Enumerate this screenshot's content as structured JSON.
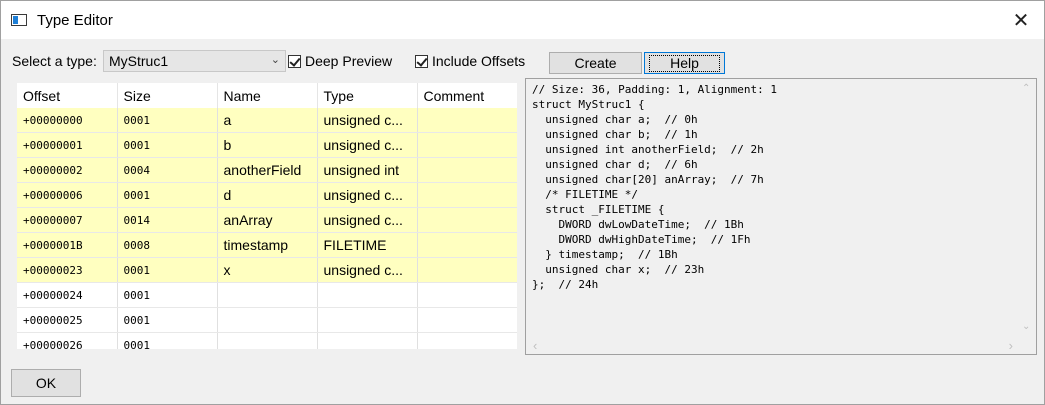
{
  "window": {
    "title": "Type Editor",
    "close_glyph": "✕"
  },
  "toolbar": {
    "select_label": "Select a type:",
    "type_value": "MyStruc1",
    "deep_preview_label": "Deep Preview",
    "include_offsets_label": "Include Offsets",
    "create_label": "Create",
    "help_label": "Help"
  },
  "grid": {
    "columns": [
      "Offset",
      "Size",
      "Name",
      "Type",
      "Comment"
    ],
    "rows": [
      {
        "offset": "+00000000",
        "size": "0001",
        "name": "a",
        "type": "unsigned c...",
        "comment": ""
      },
      {
        "offset": "+00000001",
        "size": "0001",
        "name": "b",
        "type": "unsigned c...",
        "comment": ""
      },
      {
        "offset": "+00000002",
        "size": "0004",
        "name": "anotherField",
        "type": "unsigned int",
        "comment": ""
      },
      {
        "offset": "+00000006",
        "size": "0001",
        "name": "d",
        "type": "unsigned c...",
        "comment": ""
      },
      {
        "offset": "+00000007",
        "size": "0014",
        "name": "anArray",
        "type": "unsigned c...",
        "comment": ""
      },
      {
        "offset": "+0000001B",
        "size": "0008",
        "name": "timestamp",
        "type": "FILETIME",
        "comment": ""
      },
      {
        "offset": "+00000023",
        "size": "0001",
        "name": "x",
        "type": "unsigned c...",
        "comment": ""
      },
      {
        "offset": "+00000024",
        "size": "0001",
        "name": "",
        "type": "",
        "comment": ""
      },
      {
        "offset": "+00000025",
        "size": "0001",
        "name": "",
        "type": "",
        "comment": ""
      },
      {
        "offset": "+00000026",
        "size": "0001",
        "name": "",
        "type": "",
        "comment": ""
      }
    ]
  },
  "preview": {
    "lines": [
      "// Size: 36, Padding: 1, Alignment: 1",
      "struct MyStruc1 {",
      "  unsigned char a;  // 0h",
      "  unsigned char b;  // 1h",
      "  unsigned int anotherField;  // 2h",
      "  unsigned char d;  // 6h",
      "  unsigned char[20] anArray;  // 7h",
      "  /* FILETIME */",
      "  struct _FILETIME {",
      "    DWORD dwLowDateTime;  // 1Bh",
      "    DWORD dwHighDateTime;  // 1Fh",
      "  } timestamp;  // 1Bh",
      "  unsigned char x;  // 23h",
      "};  // 24h"
    ]
  },
  "footer": {
    "ok_label": "OK"
  }
}
